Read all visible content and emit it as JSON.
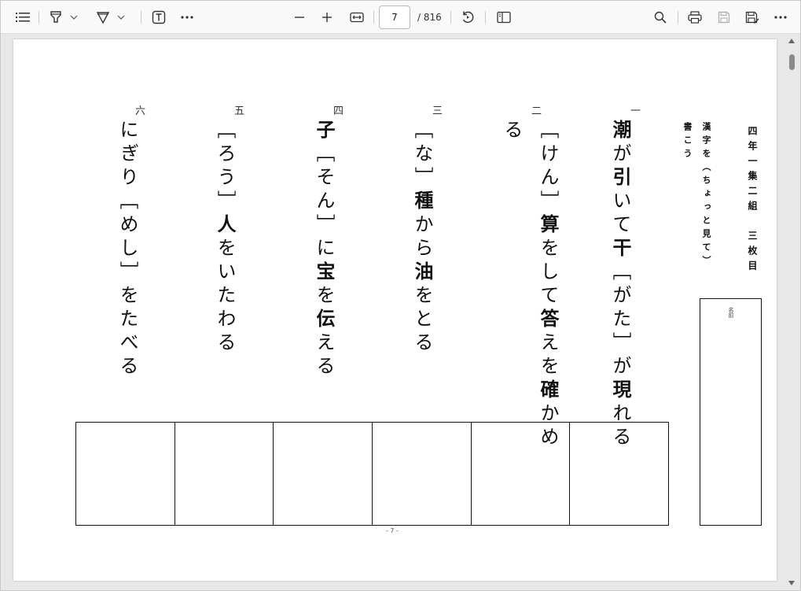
{
  "toolbar": {
    "page_current": "7",
    "page_total": "/ 816",
    "icons": [
      "list-icon",
      "highlighter-icon",
      "chevron-down-icon",
      "draw-icon",
      "chevron-down-icon",
      "text-box-icon",
      "more-icon",
      "zoom-out-icon",
      "zoom-in-icon",
      "fit-width-icon",
      "rotate-icon",
      "page-view-icon",
      "search-icon",
      "print-icon",
      "save-icon",
      "save-as-icon",
      "more-icon"
    ]
  },
  "worksheet": {
    "title": "四年一集二組　三枚目",
    "instruction_line1": "漢字を（ちょっと見て）",
    "instruction_line2": "書こう",
    "name_label": "名前",
    "footer": "- 7 -",
    "questions": [
      {
        "num": "一",
        "parts": [
          [
            "潮",
            true
          ],
          [
            "が",
            false
          ],
          [
            "引",
            true
          ],
          [
            "いて",
            false
          ],
          [
            "干",
            true
          ],
          [
            "［がた］が",
            false
          ],
          [
            "現",
            true
          ],
          [
            "れる",
            false
          ]
        ]
      },
      {
        "num": "二",
        "parts": [
          [
            "［けん］",
            false
          ],
          [
            "算",
            true
          ],
          [
            "をして",
            false
          ],
          [
            "答",
            true
          ],
          [
            "えを",
            false
          ],
          [
            "確",
            true
          ],
          [
            "かめ",
            false
          ]
        ],
        "cont": "る"
      },
      {
        "num": "三",
        "parts": [
          [
            "［な］",
            false
          ],
          [
            "種",
            true
          ],
          [
            "から",
            false
          ],
          [
            "油",
            true
          ],
          [
            "をとる",
            false
          ]
        ]
      },
      {
        "num": "四",
        "parts": [
          [
            "子",
            true
          ],
          [
            "［そん］に",
            false
          ],
          [
            "宝",
            true
          ],
          [
            "を",
            false
          ],
          [
            "伝",
            true
          ],
          [
            "える",
            false
          ]
        ]
      },
      {
        "num": "五",
        "parts": [
          [
            "［ろう］",
            false
          ],
          [
            "人",
            true
          ],
          [
            "をいたわる",
            false
          ]
        ]
      },
      {
        "num": "六",
        "parts": [
          [
            "にぎり［めし］をたべる",
            false
          ]
        ]
      }
    ]
  }
}
